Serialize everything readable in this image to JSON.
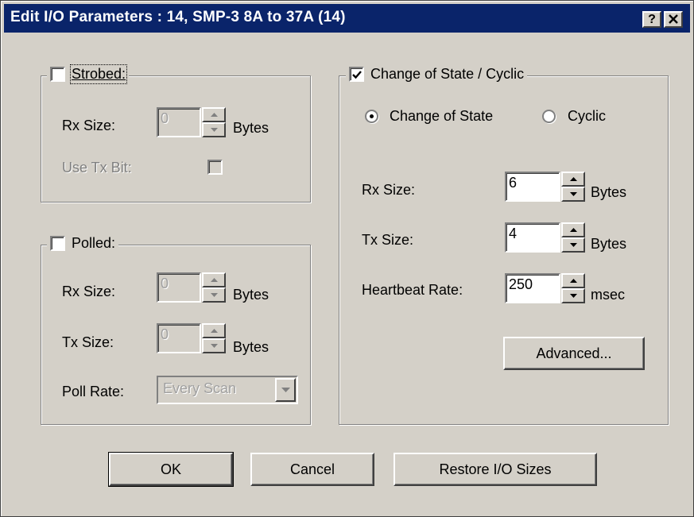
{
  "window": {
    "title": "Edit I/O Parameters : 14, SMP-3 8A to 37A (14)",
    "help_label": "?",
    "close_label": "×"
  },
  "strobed": {
    "label": "Strobed:",
    "checked": false,
    "rx_size_label": "Rx Size:",
    "rx_size_value": "0",
    "rx_size_unit": "Bytes",
    "use_tx_bit_label": "Use Tx Bit:"
  },
  "polled": {
    "label": "Polled:",
    "checked": false,
    "rx_size_label": "Rx Size:",
    "rx_size_value": "0",
    "rx_size_unit": "Bytes",
    "tx_size_label": "Tx Size:",
    "tx_size_value": "0",
    "tx_size_unit": "Bytes",
    "poll_rate_label": "Poll Rate:",
    "poll_rate_value": "Every Scan"
  },
  "cos": {
    "label": "Change of State / Cyclic",
    "checked": true,
    "radio_change_of_state": "Change of State",
    "radio_cyclic": "Cyclic",
    "selected": "Change of State",
    "rx_size_label": "Rx Size:",
    "rx_size_value": "6",
    "rx_size_unit": "Bytes",
    "tx_size_label": "Tx Size:",
    "tx_size_value": "4",
    "tx_size_unit": "Bytes",
    "heartbeat_label": "Heartbeat Rate:",
    "heartbeat_value": "250",
    "heartbeat_unit": "msec",
    "advanced_label": "Advanced..."
  },
  "buttons": {
    "ok": "OK",
    "cancel": "Cancel",
    "restore": "Restore I/O Sizes"
  },
  "colors": {
    "titlebar": "#0a246a",
    "face": "#d4d0c8"
  }
}
